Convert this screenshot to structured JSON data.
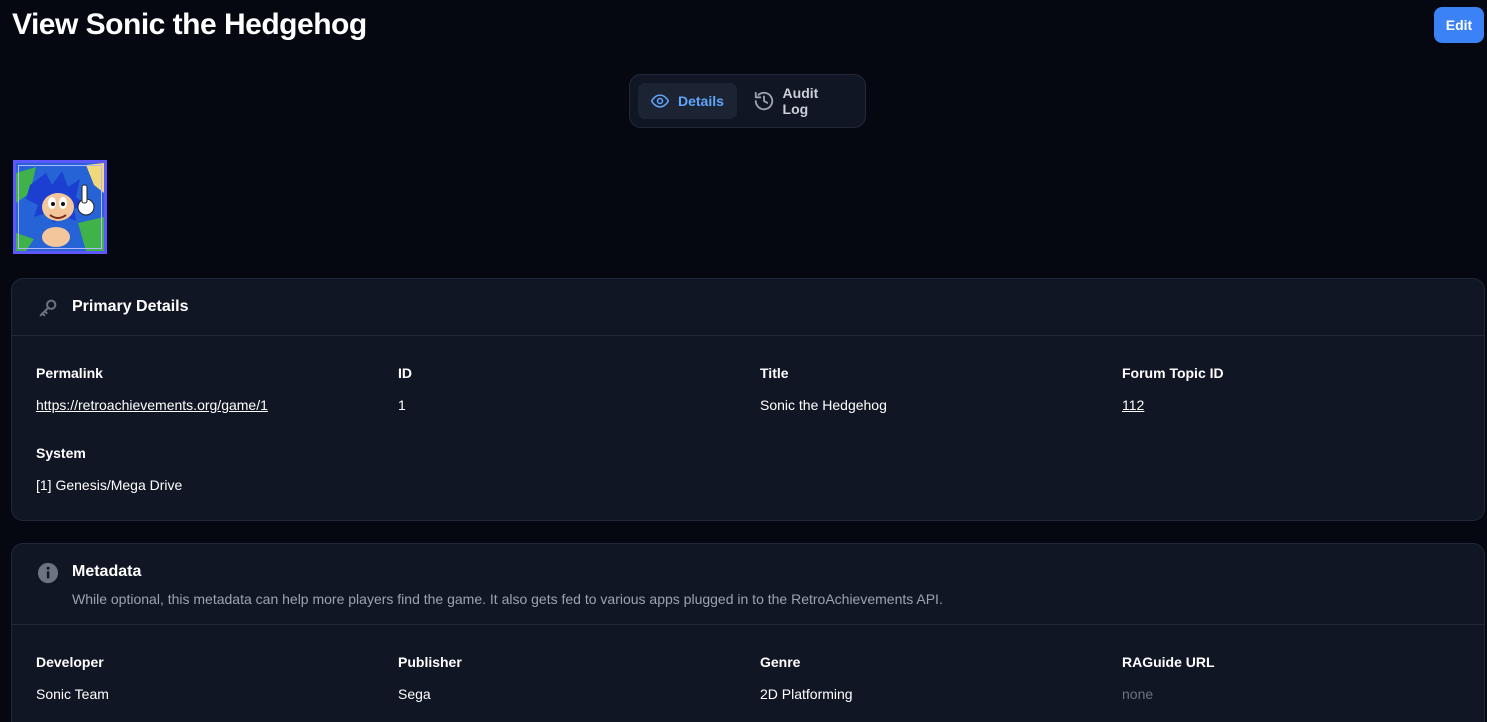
{
  "header": {
    "title": "View Sonic the Hedgehog",
    "edit_label": "Edit"
  },
  "tabs": [
    {
      "label": "Details",
      "icon": "eye-icon",
      "active": true
    },
    {
      "label": "Audit Log",
      "icon": "history-icon",
      "active": false
    }
  ],
  "primary": {
    "title": "Primary Details",
    "icon": "key-icon",
    "fields": {
      "permalink": {
        "label": "Permalink",
        "value": "https://retroachievements.org/game/1"
      },
      "id": {
        "label": "ID",
        "value": "1"
      },
      "title": {
        "label": "Title",
        "value": "Sonic the Hedgehog"
      },
      "forum_topic": {
        "label": "Forum Topic ID",
        "value": "112"
      },
      "system": {
        "label": "System",
        "value": "[1] Genesis/Mega Drive"
      }
    }
  },
  "metadata": {
    "title": "Metadata",
    "icon": "info-icon",
    "description": "While optional, this metadata can help more players find the game. It also gets fed to various apps plugged in to the RetroAchievements API.",
    "fields": {
      "developer": {
        "label": "Developer",
        "value": "Sonic Team"
      },
      "publisher": {
        "label": "Publisher",
        "value": "Sega"
      },
      "genre": {
        "label": "Genre",
        "value": "2D Platforming"
      },
      "raguide": {
        "label": "RAGuide URL",
        "value": "none"
      }
    }
  },
  "colors": {
    "background": "#050711",
    "panel": "#111625",
    "accent": "#3b82f6",
    "active_tab_text": "#60a5fa",
    "muted_text": "#9ca3af"
  }
}
